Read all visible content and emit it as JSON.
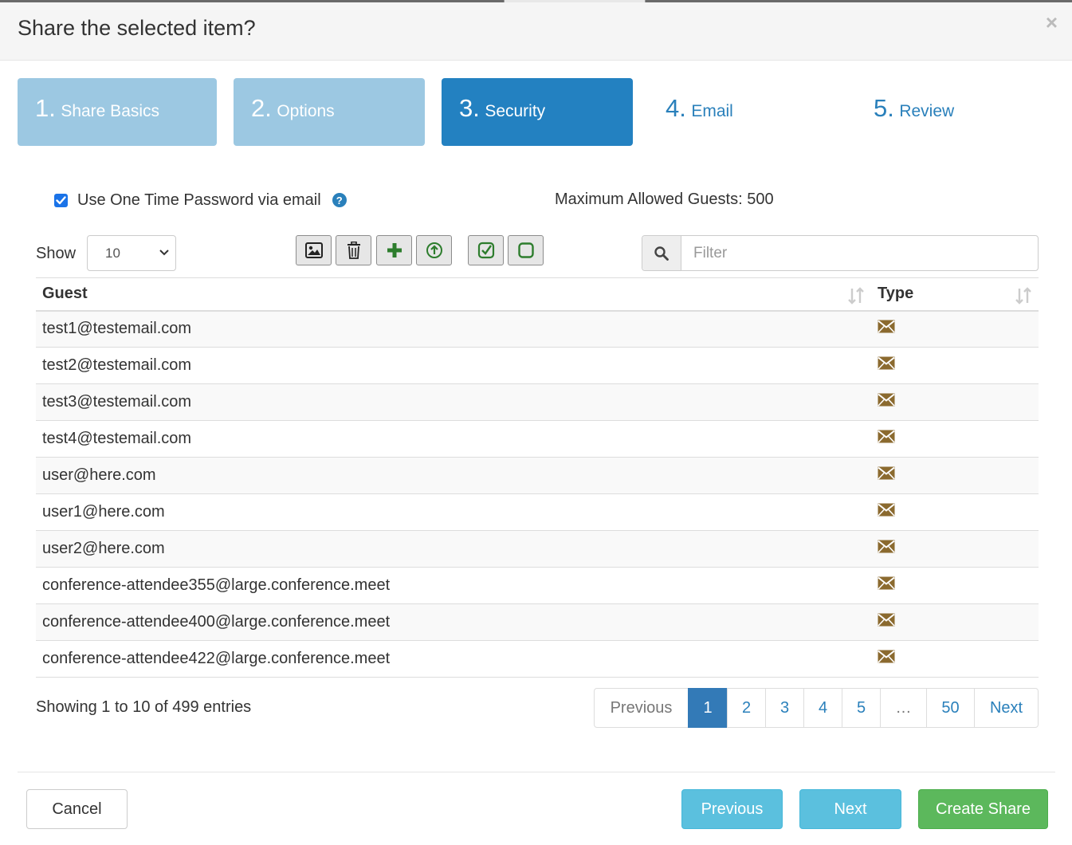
{
  "dialog": {
    "title": "Share the selected item?",
    "close_symbol": "×"
  },
  "wizard": {
    "steps": [
      {
        "num": "1.",
        "label": "Share Basics",
        "state": "done"
      },
      {
        "num": "2.",
        "label": "Options",
        "state": "done"
      },
      {
        "num": "3.",
        "label": "Security",
        "state": "active"
      },
      {
        "num": "4.",
        "label": "Email",
        "state": "todo"
      },
      {
        "num": "5.",
        "label": "Review",
        "state": "todo"
      }
    ]
  },
  "security": {
    "otp_label": "Use One Time Password via email",
    "otp_checked": true,
    "help_symbol": "?",
    "max_guests": "Maximum Allowed Guests: 500"
  },
  "table_controls": {
    "show_label": "Show",
    "page_size": "10",
    "toolbar_icons": [
      "image-icon",
      "trash-icon",
      "plus-icon",
      "upload-circle-icon",
      "check-square-icon",
      "square-icon"
    ],
    "filter_placeholder": "Filter"
  },
  "table": {
    "columns": [
      "Guest",
      "Type"
    ],
    "rows": [
      {
        "guest": "test1@testemail.com",
        "type_icon": "envelope-icon"
      },
      {
        "guest": "test2@testemail.com",
        "type_icon": "envelope-icon"
      },
      {
        "guest": "test3@testemail.com",
        "type_icon": "envelope-icon"
      },
      {
        "guest": "test4@testemail.com",
        "type_icon": "envelope-icon"
      },
      {
        "guest": "user@here.com",
        "type_icon": "envelope-icon"
      },
      {
        "guest": "user1@here.com",
        "type_icon": "envelope-icon"
      },
      {
        "guest": "user2@here.com",
        "type_icon": "envelope-icon"
      },
      {
        "guest": "conference-attendee355@large.conference.meet",
        "type_icon": "envelope-icon"
      },
      {
        "guest": "conference-attendee400@large.conference.meet",
        "type_icon": "envelope-icon"
      },
      {
        "guest": "conference-attendee422@large.conference.meet",
        "type_icon": "envelope-icon"
      }
    ]
  },
  "pagination": {
    "info": "Showing 1 to 10 of 499 entries",
    "previous": "Previous",
    "pages": [
      "1",
      "2",
      "3",
      "4",
      "5"
    ],
    "ellipsis": "…",
    "last": "50",
    "next": "Next",
    "current": "1"
  },
  "footer": {
    "cancel": "Cancel",
    "previous": "Previous",
    "next": "Next",
    "create": "Create Share"
  },
  "colors": {
    "step_done": "#9cc8e2",
    "step_active": "#2381c1",
    "link_blue": "#2a80bb",
    "envelope": "#8b6a2f",
    "success_green": "#5cb85c",
    "info_cyan": "#5bc0de"
  }
}
